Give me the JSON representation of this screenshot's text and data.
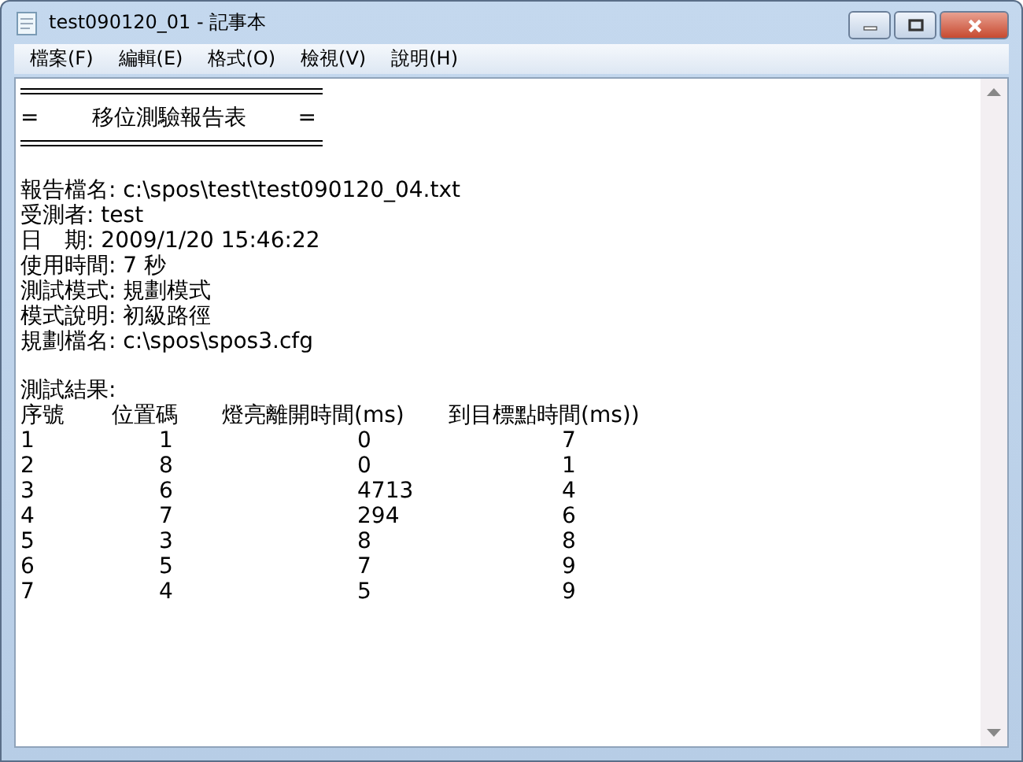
{
  "window": {
    "title": "test090120_01 - 記事本"
  },
  "menu": [
    "檔案(F)",
    "編輯(E)",
    "格式(O)",
    "檢視(V)",
    "說明(H)"
  ],
  "document": {
    "banner": {
      "left": "=",
      "title": "移位測驗報告表",
      "right": "="
    },
    "lines": [
      "報告檔名: c:\\spos\\test\\test090120_04.txt",
      "受測者: test",
      "日　期: 2009/1/20 15:46:22",
      "使用時間: 7 秒",
      "測試模式: 規劃模式",
      "模式說明: 初級路徑",
      "規劃檔名: c:\\spos\\spos3.cfg"
    ],
    "results_label": "測試結果:",
    "columns": [
      "序號",
      "位置碼",
      "燈亮離開時間(ms)",
      "到目標點時間(ms))"
    ],
    "rows": [
      [
        "1",
        "1",
        "0",
        "7"
      ],
      [
        "2",
        "8",
        "0",
        "1"
      ],
      [
        "3",
        "6",
        "4713",
        "4"
      ],
      [
        "4",
        "7",
        "294",
        "6"
      ],
      [
        "5",
        "3",
        "8",
        "8"
      ],
      [
        "6",
        "5",
        "7",
        "9"
      ],
      [
        "7",
        "4",
        "5",
        "9"
      ]
    ]
  }
}
